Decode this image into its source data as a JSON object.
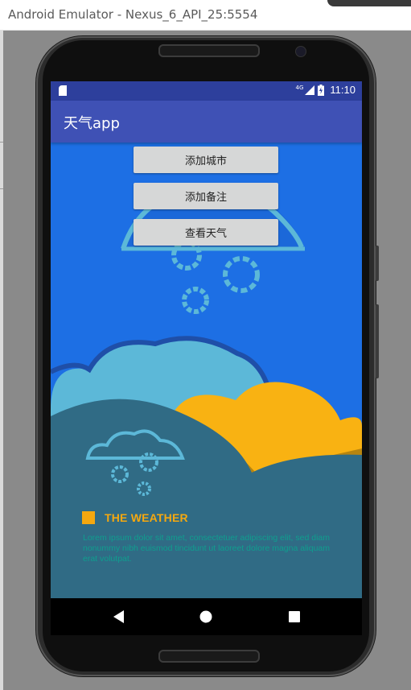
{
  "emulator": {
    "title": "Android Emulator - Nexus_6_API_25:5554"
  },
  "status_bar": {
    "time": "11:10",
    "network": "4G",
    "icons": [
      "sim-card-icon",
      "cell-signal-icon",
      "battery-charging-icon"
    ]
  },
  "app_bar": {
    "title": "天气app"
  },
  "buttons": {
    "add_city": "添加城市",
    "add_note": "添加备注",
    "view_weather": "查看天气"
  },
  "illustration": {
    "heading": "THE WEATHER",
    "body": "Lorem ipsum dolor sit amet, consectetuer adipiscing elit, sed diam nonummy nibh euismod tincidunt ut laoreet dolore magna aliquam erat volutpat.",
    "colors": {
      "sky": "#1d6fe4",
      "cloud_light": "#5cb8d8",
      "cloud_yellow": "#f9b212",
      "foreground": "#306b85",
      "accent": "#f5a80f"
    }
  },
  "nav_bar": {
    "icons": [
      "back-icon",
      "home-icon",
      "recents-icon"
    ]
  }
}
